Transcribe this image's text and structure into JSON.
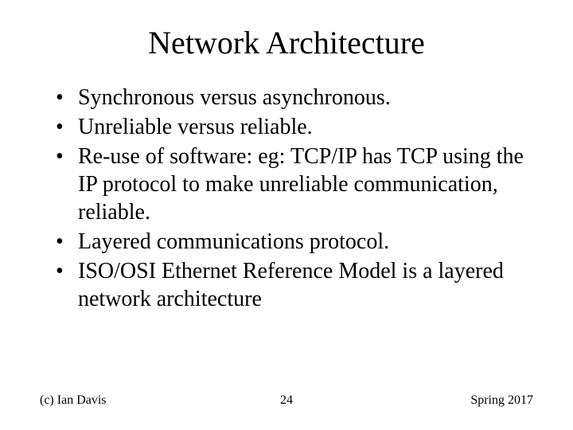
{
  "title": "Network Architecture",
  "bullets": [
    "Synchronous versus asynchronous.",
    "Unreliable versus reliable.",
    "Re-use of software: eg: TCP/IP has TCP using the IP protocol to make unreliable communication, reliable.",
    "Layered communications protocol.",
    "ISO/OSI Ethernet Reference Model is a layered network architecture"
  ],
  "footer": {
    "left": "(c) Ian Davis",
    "center": "24",
    "right": "Spring 2017"
  }
}
